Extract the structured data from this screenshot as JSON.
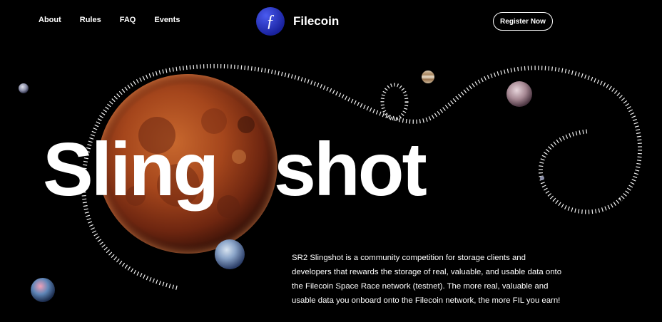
{
  "nav": {
    "items": [
      {
        "label": "About"
      },
      {
        "label": "Rules"
      },
      {
        "label": "FAQ"
      },
      {
        "label": "Events"
      }
    ]
  },
  "brand": {
    "name": "Filecoin",
    "logo_glyph": "ƒ",
    "logo_icon": "filecoin-logo-icon"
  },
  "cta": {
    "register_label": "Register Now"
  },
  "hero": {
    "title_part1": "Sling",
    "title_part2": "shot"
  },
  "description": "SR2 Slingshot is a community competition for storage clients and developers that rewards the storage of real, valuable, and usable data onto the Filecoin Space Race network (testnet). The more real, valuable and usable data you onboard onto the Filecoin network, the more FIL you earn!",
  "colors": {
    "background": "#000000",
    "text": "#ffffff",
    "brand_blue": "#1f2bb0",
    "moon_red": "#a0401a"
  }
}
